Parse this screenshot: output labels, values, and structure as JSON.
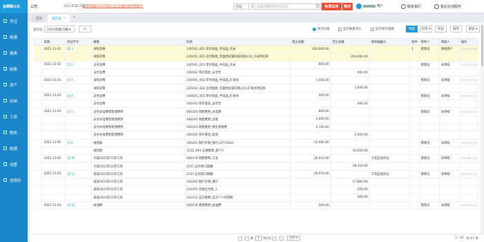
{
  "topbar": {
    "logo": "金蝶精斗云",
    "company": "公司",
    "period": "2021年第11期",
    "notice": "发票管理|2021年新公告|全面升级免费服务",
    "voucher_select": "凭证",
    "search_placeholder": "输入金额/摘要/科目/凭证号",
    "trial_button": "免费试用",
    "buy_button": "购买",
    "user_suffix": "用户",
    "contact_label": "联系我们",
    "service_label": "售后在线服务"
  },
  "sidebar": {
    "items": [
      {
        "label": "凭证"
      },
      {
        "label": "账簿"
      },
      {
        "label": "报表"
      },
      {
        "label": "结账"
      },
      {
        "label": "资产"
      },
      {
        "label": "出纳"
      },
      {
        "label": "工资"
      },
      {
        "label": "税务"
      },
      {
        "label": "助理"
      },
      {
        "label": "设置"
      },
      {
        "label": "进销存"
      }
    ]
  },
  "tabs": [
    {
      "label": "首页"
    },
    {
      "label": "查凭证",
      "close": "×"
    }
  ],
  "tab_menu": "▾",
  "filter": {
    "label": "查凭证",
    "period_value": "2021年第11期 ▾",
    "refresh": "↻",
    "options": [
      "单元问题",
      "显示数量单价",
      "显示原币金额"
    ],
    "audit_button": "审核",
    "print_button": "打印 ▾",
    "export_button": "导出",
    "sort_button": "排序",
    "more_button": "更多 ▾"
  },
  "table": {
    "headers": [
      "日期",
      "凭证字号",
      "摘要",
      "科目",
      "借方金额",
      "贷方金额",
      "原单据编号",
      "附件",
      "制单人",
      "审核人",
      "操作"
    ],
    "rows": [
      {
        "date": "2021-11-01",
        "no": "记-1",
        "summary": "采购货物",
        "account": "140501_001 库存商品_半成品_大米",
        "debit": "204,000.00",
        "credit": "",
        "doc": "",
        "att": "1",
        "maker": "管理员",
        "auditor": "系统用户",
        "hl": true
      },
      {
        "date": "",
        "no": "",
        "summary": "采购货物",
        "account": "220201_001 应付账款_华盛供应链科技有限公司_大米供应商",
        "debit": "",
        "credit": "204,000.00",
        "doc": "",
        "att": "",
        "maker": "",
        "auditor": "",
        "hl": true
      },
      {
        "date": "2021-11-02",
        "no": "记-2",
        "summary": "支付运费",
        "account": "140501_001 库存商品_半成品_大米",
        "debit": "600.00",
        "credit": "",
        "doc": "",
        "att": "",
        "maker": "管理员",
        "auditor": "未审核"
      },
      {
        "date": "",
        "no": "",
        "summary": "支付运费",
        "account": "100102 库存现金_支付宝",
        "debit": "",
        "credit": "600.00",
        "doc": "",
        "att": "",
        "maker": "",
        "auditor": ""
      },
      {
        "date": "2021-11-03",
        "no": "记-3",
        "summary": "采购货物",
        "account": "140501_002 库存商品_半成品_矿泉水",
        "debit": "1,500.00",
        "credit": "",
        "doc": "",
        "att": "",
        "maker": "管理员",
        "auditor": "未审核"
      },
      {
        "date": "",
        "no": "",
        "summary": "采购货物",
        "account": "220201_002 应付账款_华盛供应链有限公司_矿泉水供应商",
        "debit": "",
        "credit": "1,500.00",
        "doc": "",
        "att": "",
        "maker": "",
        "auditor": ""
      },
      {
        "date": "2021-11-03",
        "no": "记-4",
        "summary": "支付运费",
        "account": "140501_002 库存商品_半成品_矿泉水",
        "debit": "400.00",
        "credit": "",
        "doc": "",
        "att": "",
        "maker": "管理员",
        "auditor": "未审核"
      },
      {
        "date": "",
        "no": "",
        "summary": "支付运费",
        "account": "100102 库存现金_支付宝",
        "debit": "",
        "credit": "400.00",
        "doc": "",
        "att": "",
        "maker": "",
        "auditor": ""
      },
      {
        "date": "2021-11-04",
        "no": "记-5",
        "summary": "支付水电费等管理费用",
        "account": "560104 销售费用_水电费",
        "debit": "800.00",
        "credit": "",
        "doc": "",
        "att": "",
        "maker": "管理员",
        "auditor": "未审核"
      },
      {
        "date": "",
        "no": "",
        "summary": "支付水电费等管理费用",
        "account": "560102 销售费用_房租",
        "debit": "2,000.00",
        "credit": "",
        "doc": "",
        "att": "",
        "maker": "",
        "auditor": ""
      },
      {
        "date": "",
        "no": "",
        "summary": "支付水电费等管理费用",
        "account": "560103 销售费用_物业管理费",
        "debit": "2,700.00",
        "credit": "",
        "doc": "",
        "att": "",
        "maker": "",
        "auditor": ""
      },
      {
        "date": "",
        "no": "",
        "summary": "支付水电费等管理费用",
        "account": "100101 库存现金_现金",
        "debit": "",
        "credit": "5,500.00",
        "doc": "",
        "att": "",
        "maker": "",
        "auditor": ""
      },
      {
        "date": "2021-11-05",
        "no": "记-6",
        "summary": "收到款",
        "account": "100201 银行存款_银行(工行1002)",
        "debit": "10,000.00",
        "credit": "",
        "doc": "",
        "att": "",
        "maker": "管理员",
        "auditor": "未审核"
      },
      {
        "date": "",
        "no": "",
        "summary": "收到款",
        "account": "1122_004 应收账款_客户4",
        "debit": "",
        "credit": "10,000.00",
        "doc": "",
        "att": "",
        "maker": "",
        "auditor": ""
      },
      {
        "date": "2021-11-05",
        "no": "记-10",
        "summary": "计提2021年11月工资",
        "account": "560119 销售费用_工资",
        "debit": "28,410.00",
        "credit": "",
        "doc": "工资自动凭证",
        "att": "",
        "maker": "管理员",
        "auditor": "未审核"
      },
      {
        "date": "",
        "no": "",
        "summary": "计提2021年11月工资",
        "account": "2211 应付职工薪酬",
        "debit": "",
        "credit": "28,410.00",
        "doc": "",
        "att": "",
        "maker": "",
        "auditor": ""
      },
      {
        "date": "2021-11-03",
        "no": "记-11",
        "summary": "发放2021年11月工资",
        "account": "2211 应付职工薪酬",
        "debit": "28,410.00",
        "credit": "",
        "doc": "工资自动凭证",
        "att": "",
        "maker": "管理员",
        "auditor": "未审核"
      },
      {
        "date": "",
        "no": "",
        "summary": "发放2021年11月工资",
        "account": "100202 银行存款_建行",
        "debit": "",
        "credit": "27,860.00",
        "doc": "",
        "att": "",
        "maker": "",
        "auditor": ""
      },
      {
        "date": "",
        "no": "",
        "summary": "发放2021年11月工资",
        "account": "224101 其他应付款_1",
        "debit": "",
        "credit": "250.00",
        "doc": "",
        "att": "",
        "maker": "",
        "auditor": ""
      },
      {
        "date": "",
        "no": "",
        "summary": "发放2021年11月工资",
        "account": "222112 应交税费_应交个人所得税",
        "debit": "",
        "credit": "300.00",
        "doc": "",
        "att": "",
        "maker": "",
        "auditor": ""
      },
      {
        "date": "2021-11-04",
        "no": "记-12",
        "summary": "加油费",
        "account": "560216 管理费用_加油费",
        "debit": "100.00",
        "credit": "",
        "doc": "",
        "att": "",
        "maker": "管理员",
        "auditor": "未审核"
      }
    ],
    "ops_text": "修改·删除·复制"
  },
  "pager": {
    "page_label": "第",
    "page_value": "1",
    "total_pages": "共1页",
    "page_size": "100 ▾",
    "range": "1 - 67",
    "total": "共 67 条"
  }
}
